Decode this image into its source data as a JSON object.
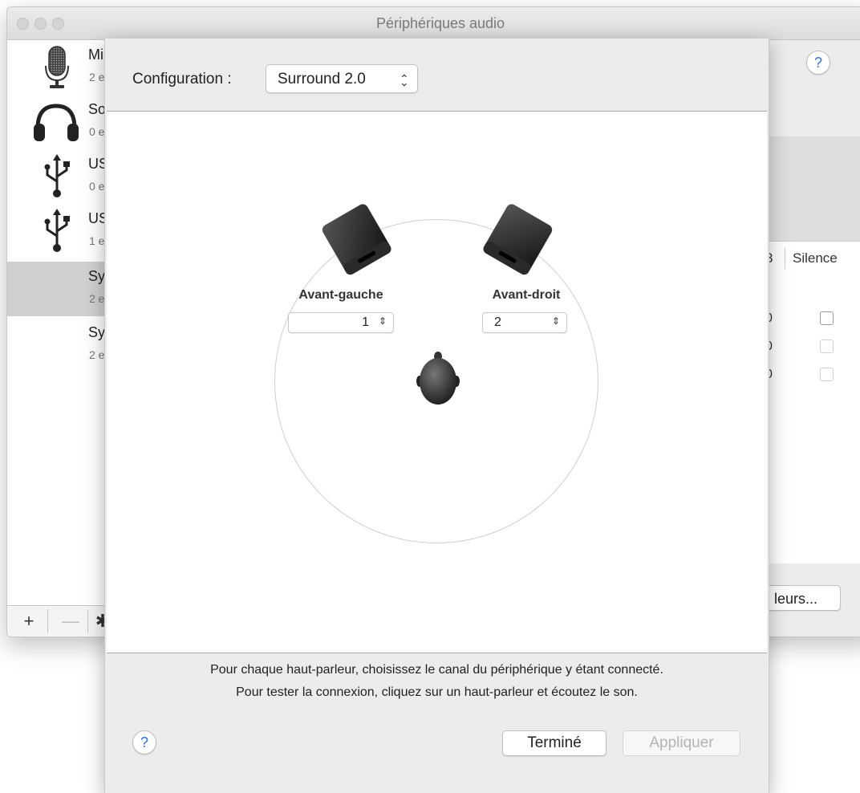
{
  "window": {
    "title": "Périphériques audio",
    "help": "?"
  },
  "sidebar": {
    "devices": [
      {
        "name": "Mi",
        "sub": "2 e",
        "icon": "microphone-icon",
        "selected": false
      },
      {
        "name": "So",
        "sub": "0 e",
        "icon": "headphones-icon",
        "selected": false
      },
      {
        "name": "US",
        "sub": "0 e",
        "icon": "usb-icon",
        "selected": false
      },
      {
        "name": "US",
        "sub": "1 e",
        "icon": "usb-icon",
        "selected": false
      },
      {
        "name": "Sy",
        "sub": "2 e",
        "icon": "none",
        "selected": true
      },
      {
        "name": "Sy",
        "sub": "2 e",
        "icon": "none",
        "selected": false
      }
    ],
    "toolbar": {
      "add": "+",
      "remove": "—",
      "settings": "✱"
    }
  },
  "right": {
    "col_b": "3",
    "col_silence": "Silence",
    "rows": [
      {
        "value": "0",
        "checkbox_enabled": true
      },
      {
        "value": "0",
        "checkbox_enabled": false
      },
      {
        "value": "0",
        "checkbox_enabled": false
      }
    ],
    "button_label": "leurs..."
  },
  "sheet": {
    "config_label": "Configuration :",
    "config_value": "Surround 2.0",
    "speakers": {
      "left": {
        "label": "Avant-gauche",
        "channel": "1"
      },
      "right": {
        "label": "Avant-droit",
        "channel": "2"
      }
    },
    "instructions": [
      "Pour chaque haut-parleur, choisissez le canal du périphérique y étant connecté.",
      "Pour tester la connexion, cliquez sur un haut-parleur et écoutez le son."
    ],
    "help": "?",
    "done_label": "Terminé",
    "apply_label": "Appliquer"
  }
}
